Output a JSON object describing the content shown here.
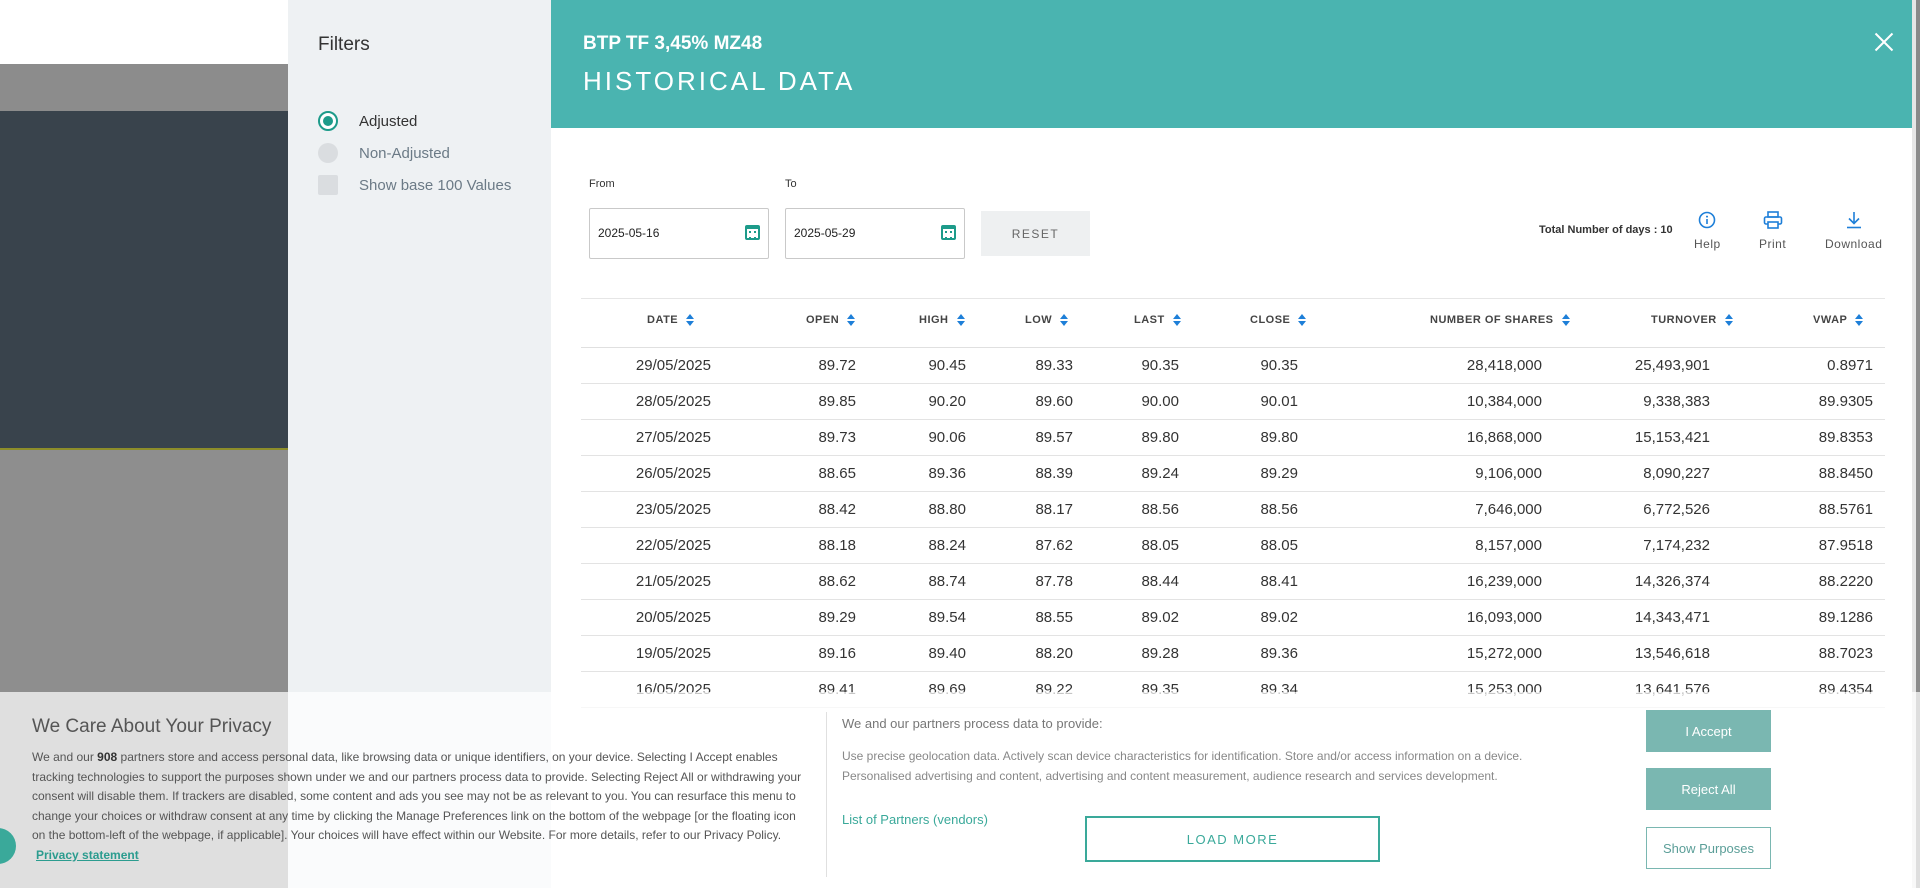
{
  "filters": {
    "title": "Filters",
    "options": [
      {
        "label": "Adjusted",
        "type": "radio",
        "selected": true
      },
      {
        "label": "Non-Adjusted",
        "type": "radio",
        "selected": false
      },
      {
        "label": "Show base 100 Values",
        "type": "checkbox",
        "selected": false
      }
    ]
  },
  "header": {
    "instrument": "BTP TF 3,45% MZ48",
    "title": "HISTORICAL DATA",
    "close_icon": "close-icon"
  },
  "date_range": {
    "from_label": "From",
    "from_value": "2025-05-16",
    "to_label": "To",
    "to_value": "2025-05-29",
    "reset_label": "RESET"
  },
  "toolbar": {
    "total_days": "Total Number of days : 10",
    "help": "Help",
    "print": "Print",
    "download": "Download"
  },
  "table": {
    "columns": [
      "DATE",
      "OPEN",
      "HIGH",
      "LOW",
      "LAST",
      "CLOSE",
      "NUMBER OF SHARES",
      "TURNOVER",
      "VWAP"
    ],
    "rows": [
      [
        "29/05/2025",
        "89.72",
        "90.45",
        "89.33",
        "90.35",
        "90.35",
        "28,418,000",
        "25,493,901",
        "0.8971"
      ],
      [
        "28/05/2025",
        "89.85",
        "90.20",
        "89.60",
        "90.00",
        "90.01",
        "10,384,000",
        "9,338,383",
        "89.9305"
      ],
      [
        "27/05/2025",
        "89.73",
        "90.06",
        "89.57",
        "89.80",
        "89.80",
        "16,868,000",
        "15,153,421",
        "89.8353"
      ],
      [
        "26/05/2025",
        "88.65",
        "89.36",
        "88.39",
        "89.24",
        "89.29",
        "9,106,000",
        "8,090,227",
        "88.8450"
      ],
      [
        "23/05/2025",
        "88.42",
        "88.80",
        "88.17",
        "88.56",
        "88.56",
        "7,646,000",
        "6,772,526",
        "88.5761"
      ],
      [
        "22/05/2025",
        "88.18",
        "88.24",
        "87.62",
        "88.05",
        "88.05",
        "8,157,000",
        "7,174,232",
        "87.9518"
      ],
      [
        "21/05/2025",
        "88.62",
        "88.74",
        "87.78",
        "88.44",
        "88.41",
        "16,239,000",
        "14,326,374",
        "88.2220"
      ],
      [
        "20/05/2025",
        "89.29",
        "89.54",
        "88.55",
        "89.02",
        "89.02",
        "16,093,000",
        "14,343,471",
        "89.1286"
      ],
      [
        "19/05/2025",
        "89.16",
        "89.40",
        "88.20",
        "89.28",
        "89.36",
        "15,272,000",
        "13,546,618",
        "88.7023"
      ],
      [
        "16/05/2025",
        "89.41",
        "89.69",
        "89.22",
        "89.35",
        "89.34",
        "15,253,000",
        "13,641,576",
        "89.4354"
      ]
    ]
  },
  "cookie": {
    "title": "We Care About Your Privacy",
    "body_prefix": "We and our",
    "partner_count": "908",
    "body": "partners store and access personal data, like browsing data or unique identifiers, on your device. Selecting I Accept enables tracking technologies to support the purposes shown under we and our partners process data to provide. Selecting Reject All or withdrawing your consent will disable them. If trackers are disabled, some content and ads you see may not be as relevant to you. You can resurface this menu to change your choices or withdraw consent at any time by clicking the Manage Preferences link on the bottom of the webpage [or the floating icon on the bottom-left of the webpage, if applicable]. Your choices will have effect within our Website. For more details, refer to our Privacy Policy.",
    "privacy_link": "Privacy statement",
    "purposes_title": "We and our partners process data to provide:",
    "purposes": "Use precise geolocation data. Actively scan device characteristics for identification. Store and/or access information on a device. Personalised advertising and content, advertising and content measurement, audience research and services development.",
    "partners_link": "List of Partners (vendors)",
    "load_more": "LOAD MORE",
    "accept": "I Accept",
    "reject": "Reject All",
    "show_purposes": "Show Purposes"
  }
}
